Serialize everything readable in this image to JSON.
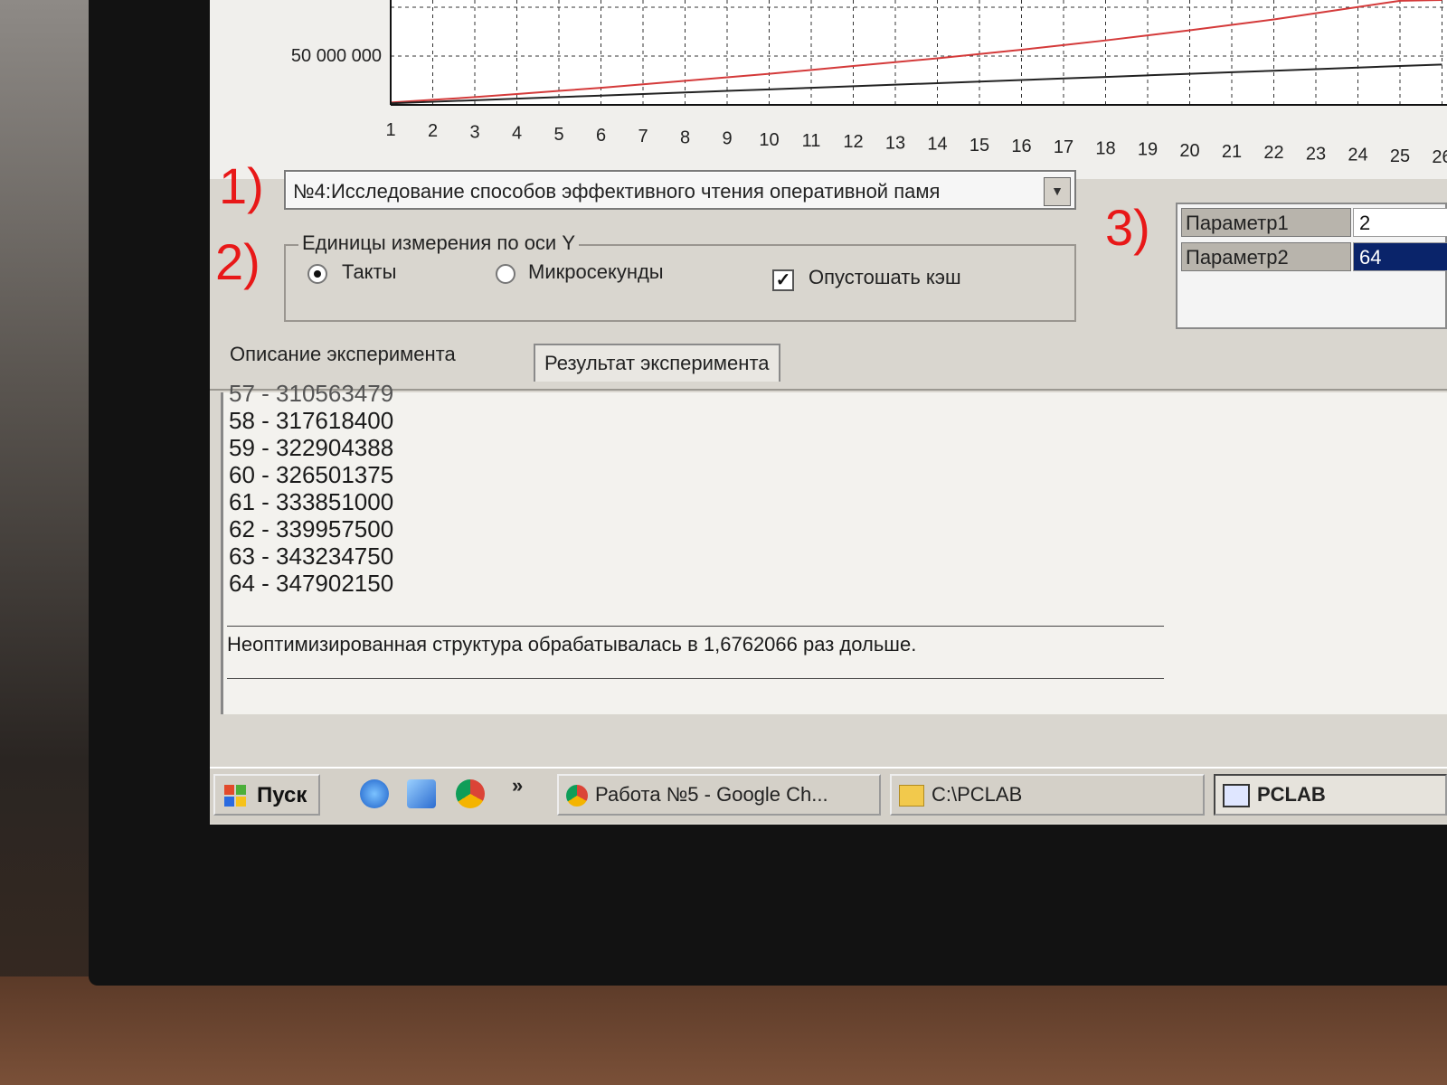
{
  "chart": {
    "y_tick_visible": "50 000 000",
    "x_ticks": [
      "1",
      "2",
      "3",
      "4",
      "5",
      "6",
      "7",
      "8",
      "9",
      "10",
      "11",
      "12",
      "13",
      "14",
      "15",
      "16",
      "17",
      "18",
      "19",
      "20",
      "21",
      "22",
      "23",
      "24",
      "25",
      "26"
    ],
    "series_colors": {
      "red": "#d43a3a",
      "black": "#222222"
    }
  },
  "chart_data": {
    "type": "line",
    "x": [
      1,
      2,
      3,
      4,
      5,
      6,
      7,
      8,
      9,
      10,
      11,
      12,
      13,
      14,
      15,
      16,
      17,
      18,
      19,
      20,
      21,
      22,
      23,
      24,
      25,
      26
    ],
    "series": [
      {
        "color": "#d43a3a",
        "values": [
          3000000,
          6500000,
          10000000,
          14000000,
          18000000,
          22000000,
          26500000,
          31000000,
          35500000,
          40000000,
          45000000,
          50000000,
          55000000,
          60000000,
          65500000,
          71000000,
          77000000,
          83000000,
          89500000,
          96000000,
          103000000,
          110000000,
          118000000,
          126000000,
          134000000,
          142000000
        ]
      },
      {
        "color": "#222222",
        "values": [
          2000000,
          4000000,
          6000000,
          8000000,
          10000000,
          12000000,
          14000000,
          16000000,
          18000000,
          20000000,
          22000000,
          24000000,
          26000000,
          28000000,
          30000000,
          32000000,
          34000000,
          36000000,
          38000000,
          40000000,
          42000000,
          44000000,
          46000000,
          48000000,
          50000000,
          52000000
        ]
      }
    ],
    "grid": true
  },
  "annotations": {
    "a1": "1)",
    "a2": "2)",
    "a3": "3)"
  },
  "experiment": {
    "selected": "№4:Исследование способов эффективного  чтения оперативной памя"
  },
  "units": {
    "legend": "Единицы измерения по оси Y",
    "option1": "Такты",
    "option2": "Микросекунды",
    "selected": "Такты",
    "checkbox_label": "Опустошать кэш",
    "checkbox_checked": true
  },
  "params": [
    {
      "name": "Параметр1",
      "value": "2"
    },
    {
      "name": "Параметр2",
      "value": "64"
    }
  ],
  "tabs": [
    {
      "label": "Описание эксперимента"
    },
    {
      "label": "Результат эксперимента",
      "active": true
    }
  ],
  "results": {
    "lines": [
      "57 - 310563479",
      "58 - 317618400",
      "59 - 322904388",
      "60 - 326501375",
      "61 - 333851000",
      "62 - 339957500",
      "63 - 343234750",
      "64 - 347902150"
    ],
    "summary": "Неоптимизированная структура обрабатывалась в 1,6762066 раз дольше."
  },
  "taskbar": {
    "start": "Пуск",
    "more": "»",
    "items": [
      {
        "label": "Работа №5 - Google Ch..."
      },
      {
        "label": "C:\\PCLAB"
      },
      {
        "label": "PCLAB",
        "active": true
      }
    ]
  }
}
